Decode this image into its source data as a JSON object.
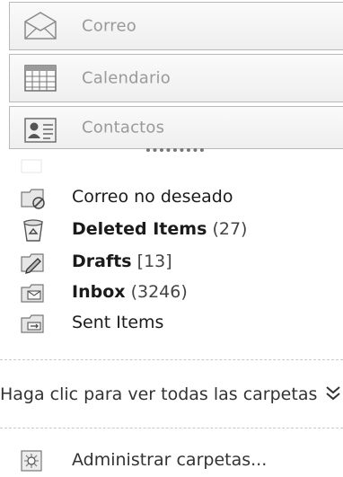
{
  "nav": {
    "mail_label": "Correo",
    "calendar_label": "Calendario",
    "contacts_label": "Contactos"
  },
  "folders": [
    {
      "name": "Correo no deseado",
      "count": "",
      "bold": false,
      "icon": "junk-folder-icon"
    },
    {
      "name": "Deleted Items",
      "count": "(27)",
      "bold": true,
      "icon": "trash-can-icon"
    },
    {
      "name": "Drafts",
      "count": "[13]",
      "bold": true,
      "icon": "drafts-folder-icon"
    },
    {
      "name": "Inbox",
      "count": "(3246)",
      "bold": true,
      "icon": "inbox-folder-icon"
    },
    {
      "name": "Sent Items",
      "count": "",
      "bold": false,
      "icon": "sent-folder-icon"
    }
  ],
  "all_folders_label": "Haga clic para ver todas las carpetas",
  "manage_label": "Administrar carpetas..."
}
